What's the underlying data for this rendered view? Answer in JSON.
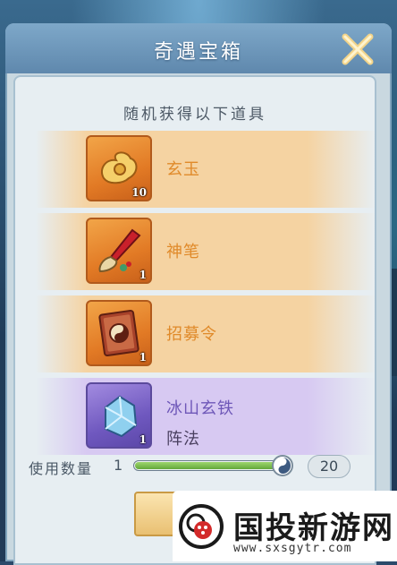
{
  "dialog": {
    "title": "奇遇宝箱",
    "subtitle": "随机获得以下道具"
  },
  "items": [
    {
      "name": "玄玉",
      "count": "10",
      "icon": "jade-icon",
      "tier": "gold"
    },
    {
      "name": "神笔",
      "count": "1",
      "icon": "brush-icon",
      "tier": "gold"
    },
    {
      "name": "招募令",
      "count": "1",
      "icon": "recruit-book-icon",
      "tier": "gold"
    },
    {
      "name": "冰山玄铁",
      "sub": "阵法",
      "count": "1",
      "icon": "ice-iron-icon",
      "tier": "purple"
    }
  ],
  "quantity": {
    "label": "使用数量",
    "value": "1",
    "max": "20",
    "progress": 1.0
  },
  "watermark": {
    "title": "国投新游网",
    "url": "www.sxsgytr.com"
  },
  "colors": {
    "header": "#6f98bc",
    "gold_text": "#e08a2a",
    "purple_text": "#6e57b8",
    "slider_fill": "#7fbf4f"
  }
}
